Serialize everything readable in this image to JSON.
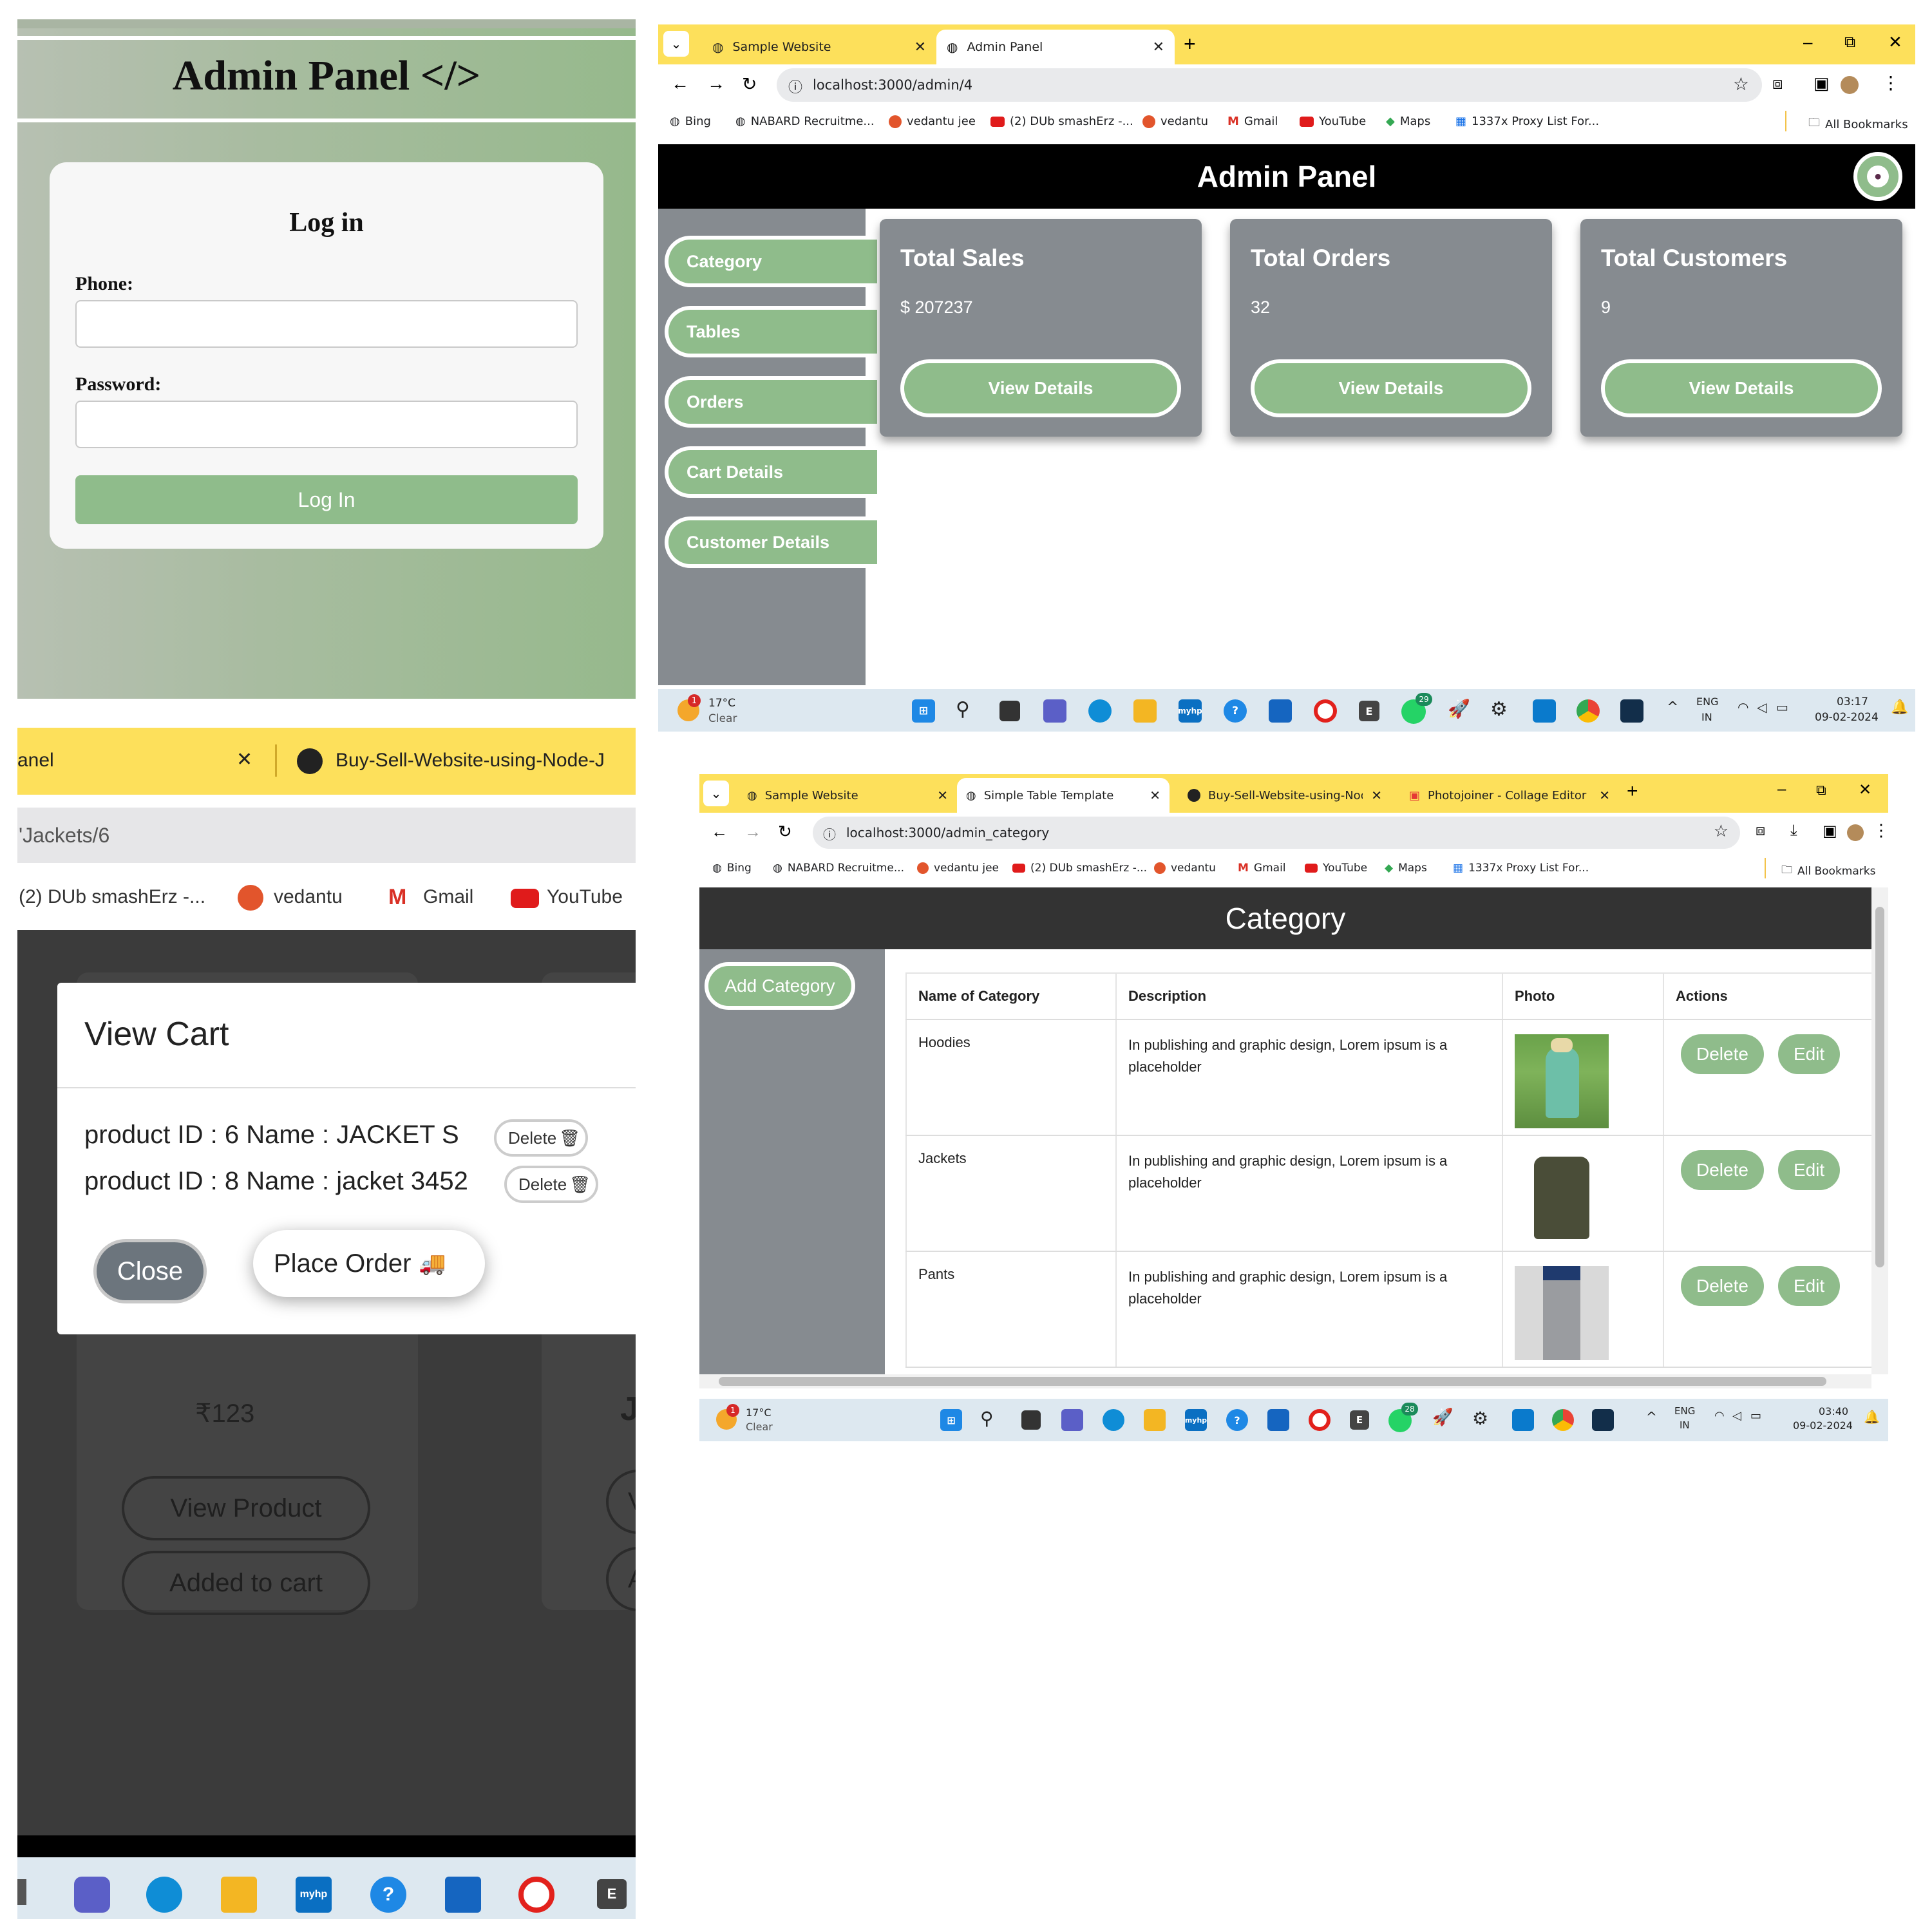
{
  "login_panel": {
    "header": "Admin Panel </>",
    "form_title": "Log in",
    "phone_label": "Phone:",
    "password_label": "Password:",
    "submit_label": "Log In"
  },
  "admin_window": {
    "tabs": [
      {
        "title": "Sample Website",
        "active": false
      },
      {
        "title": "Admin Panel",
        "active": true
      }
    ],
    "url": "localhost:3000/admin/4",
    "bookmarks": [
      "Bing",
      "NABARD Recruitme...",
      "vedantu jee",
      "(2) DUb smashErz -...",
      "vedantu",
      "Gmail",
      "YouTube",
      "Maps",
      "1337x Proxy List For..."
    ],
    "all_bookmarks": "All Bookmarks",
    "page_title": "Admin Panel",
    "sidebar": [
      "Category",
      "Tables",
      "Orders",
      "Cart Details",
      "Customer Details"
    ],
    "cards": [
      {
        "title": "Total Sales",
        "value": "$ 207237",
        "button": "View Details"
      },
      {
        "title": "Total Orders",
        "value": "32",
        "button": "View Details"
      },
      {
        "title": "Total Customers",
        "value": "9",
        "button": "View Details"
      }
    ],
    "taskbar": {
      "weather_badge": "1",
      "temp": "17°C",
      "condition": "Clear",
      "lang": "ENG",
      "region": "IN",
      "time": "03:17",
      "date": "09-02-2024",
      "whatsapp_count": "29"
    }
  },
  "cart_panel": {
    "tab_fragment": "anel",
    "tab2_title": "Buy-Sell-Website-using-Node-J",
    "url_fragment": "'Jackets/6",
    "bookmarks": [
      "(2) DUb smashErz -...",
      "vedantu",
      "Gmail",
      "YouTube"
    ],
    "modal_title": "View Cart",
    "items": [
      {
        "text": "product ID : 6 Name : JACKET S",
        "delete": "Delete"
      },
      {
        "text": "product ID : 8 Name : jacket 3452",
        "delete": "Delete"
      }
    ],
    "close_label": "Close",
    "place_order_label": "Place Order",
    "price": "₹123",
    "view_product_label": "View Product",
    "added_label": "Added to cart",
    "partial_heading": "Jc",
    "partial_btn1": "Vi",
    "partial_btn2": "A"
  },
  "category_window": {
    "tabs": [
      {
        "title": "Sample Website",
        "active": false
      },
      {
        "title": "Simple Table Template",
        "active": true
      },
      {
        "title": "Buy-Sell-Website-using-Node-J",
        "active": false
      },
      {
        "title": "Photojoiner - Collage Editor",
        "active": false
      }
    ],
    "url": "localhost:3000/admin_category",
    "bookmarks": [
      "Bing",
      "NABARD Recruitme...",
      "vedantu jee",
      "(2) DUb smashErz -...",
      "vedantu",
      "Gmail",
      "YouTube",
      "Maps",
      "1337x Proxy List For..."
    ],
    "all_bookmarks": "All Bookmarks",
    "page_title": "Category",
    "add_button": "Add Category",
    "columns": [
      "Name of Category",
      "Description",
      "Photo",
      "Actions"
    ],
    "rows": [
      {
        "name": "Hoodies",
        "description": "In publishing and graphic design, Lorem ipsum is a placeholder",
        "delete": "Delete",
        "edit": "Edit"
      },
      {
        "name": "Jackets",
        "description": "In publishing and graphic design, Lorem ipsum is a placeholder",
        "delete": "Delete",
        "edit": "Edit"
      },
      {
        "name": "Pants",
        "description": "In publishing and graphic design, Lorem ipsum is a placeholder",
        "delete": "Delete",
        "edit": "Edit"
      }
    ],
    "taskbar": {
      "weather_badge": "1",
      "temp": "17°C",
      "condition": "Clear",
      "lang": "ENG",
      "region": "IN",
      "time": "03:40",
      "date": "09-02-2024",
      "whatsapp_count": "28"
    }
  },
  "colors": {
    "accent_green": "#8fbc8b",
    "chrome_yellow": "#fde05b",
    "card_gray": "#868b90",
    "sidebar_gray": "#868b90"
  }
}
